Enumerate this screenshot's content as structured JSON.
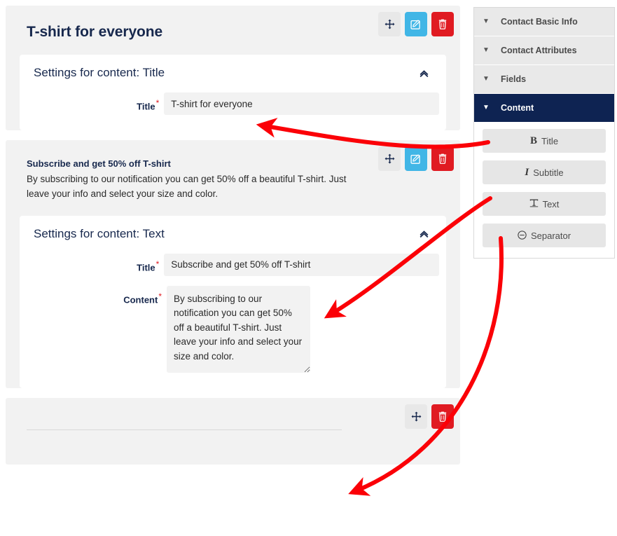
{
  "page": {
    "heading": "T-shirt for everyone"
  },
  "colors": {
    "accent_navy": "#0e2352",
    "edit_blue": "#41b6e6",
    "delete_red": "#e01b22",
    "move_grey": "#e8e8e8",
    "card_bg": "#f2f2f2",
    "annotation_red": "#fb0007",
    "required_star": "#e01b22"
  },
  "toolbar": {
    "move_label": "move-icon",
    "edit_label": "edit-icon",
    "delete_label": "trash-icon"
  },
  "cards": [
    {
      "type": "title",
      "preview_heading": "T-shirt for everyone",
      "settings": {
        "panel_title": "Settings for content: Title",
        "collapse_icon": "angle-double-up-icon",
        "fields": [
          {
            "label": "Title",
            "required": true,
            "value": "T-shirt for everyone",
            "placeholder": ""
          }
        ]
      }
    },
    {
      "type": "text",
      "preview_heading": "Subscribe and get 50% off T-shirt",
      "preview_body": "By subscribing to our notification you can get 50% off a beautiful T-shirt. Just leave your info and select your size and color.",
      "settings": {
        "panel_title": "Settings for content: Text",
        "collapse_icon": "angle-double-up-icon",
        "fields": [
          {
            "label": "Title",
            "required": true,
            "value": "Subscribe and get 50% off T-shirt",
            "placeholder": ""
          },
          {
            "label": "Content",
            "required": true,
            "value": "By subscribing to our notification you can get 50% off a beautiful T-shirt. Just leave your info and select your size and color.",
            "placeholder": ""
          }
        ]
      }
    },
    {
      "type": "separator",
      "preview_heading": "",
      "settings": null
    }
  ],
  "sidebar": {
    "items": [
      {
        "label": "Contact Basic Info",
        "active": false,
        "caret": "▼"
      },
      {
        "label": "Contact Attributes",
        "active": false,
        "caret": "▼"
      },
      {
        "label": "Fields",
        "active": false,
        "caret": "▼"
      },
      {
        "label": "Content",
        "active": true,
        "caret": "▼"
      }
    ],
    "content_buttons": [
      {
        "label": "Title",
        "icon_glyph": "B",
        "icon_name": "bold-icon"
      },
      {
        "label": "Subtitle",
        "icon_glyph": "I",
        "icon_name": "italic-icon"
      },
      {
        "label": "Text",
        "icon_glyph": "T",
        "icon_name": "text-width-icon"
      },
      {
        "label": "Separator",
        "icon_glyph": "⊖",
        "icon_name": "circle-minus-icon"
      }
    ]
  },
  "annotations": [
    {
      "name": "arrow-title-button-to-title-field",
      "from": "Title content button",
      "to": "Title settings input"
    },
    {
      "name": "arrow-text-button-to-text-settings",
      "from": "Text content button",
      "to": "Text settings Title input"
    },
    {
      "name": "arrow-separator-button-to-separator-card",
      "from": "Separator content button",
      "to": "Separator card"
    }
  ]
}
